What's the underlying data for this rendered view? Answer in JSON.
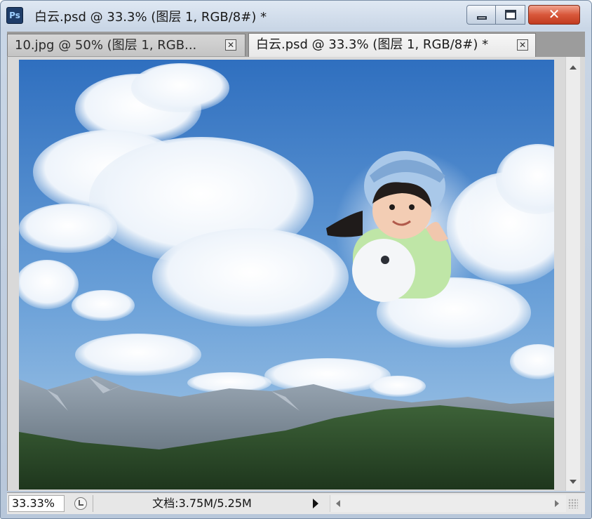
{
  "window": {
    "app_icon": "Ps",
    "title": "白云.psd @ 33.3% (图层 1, RGB/8#) *",
    "close_glyph": "✕"
  },
  "tabs": [
    {
      "label": "10.jpg @ 50% (图层 1, RGB...",
      "close": "✕",
      "active": false
    },
    {
      "label": "白云.psd @ 33.3% (图层 1, RGB/8#) *",
      "close": "✕",
      "active": true
    }
  ],
  "canvas": {
    "scene": [
      "sky",
      "clouds",
      "mountains",
      "forest",
      "child-photo-composite"
    ],
    "colors": {
      "sky_top": "#2f6fbf",
      "sky_bottom": "#9ec4e6",
      "mountain": "#6f8090",
      "forest": "#2e4f2c"
    }
  },
  "status": {
    "zoom": "33.33%",
    "doc_info": "文档:3.75M/5.25M"
  }
}
